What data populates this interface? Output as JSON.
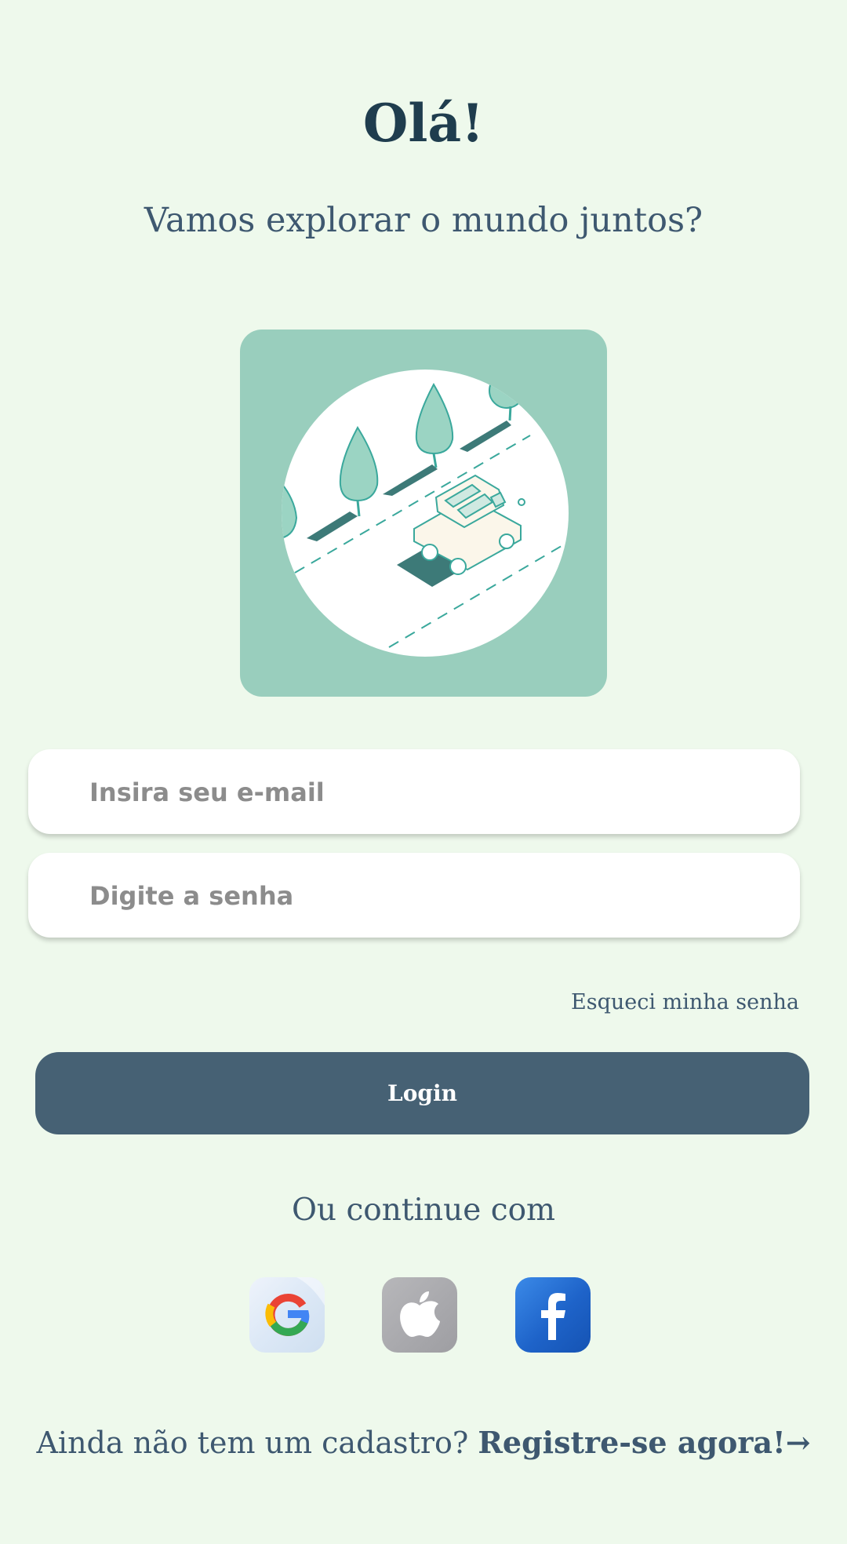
{
  "header": {
    "title": "Olá!",
    "subtitle": "Vamos explorar o mundo juntos?"
  },
  "illustration": {
    "icon": "car-road-illustration",
    "background_color": "#99cebd"
  },
  "form": {
    "email_placeholder": "Insira seu e-mail",
    "password_placeholder": "Digite a senha",
    "forgot_password_label": "Esqueci minha senha",
    "login_label": "Login"
  },
  "social": {
    "divider_label": "Ou continue com",
    "providers": [
      {
        "name": "Google",
        "icon": "google-icon"
      },
      {
        "name": "Apple",
        "icon": "apple-icon"
      },
      {
        "name": "Facebook",
        "icon": "facebook-icon"
      }
    ]
  },
  "footer": {
    "prompt": "Ainda não tem um cadastro?",
    "register_label": "Registre-se agora!",
    "arrow": "→"
  },
  "colors": {
    "background": "#eef9ec",
    "primary": "#466174",
    "title": "#1f3d4e",
    "text": "#3e5870"
  }
}
